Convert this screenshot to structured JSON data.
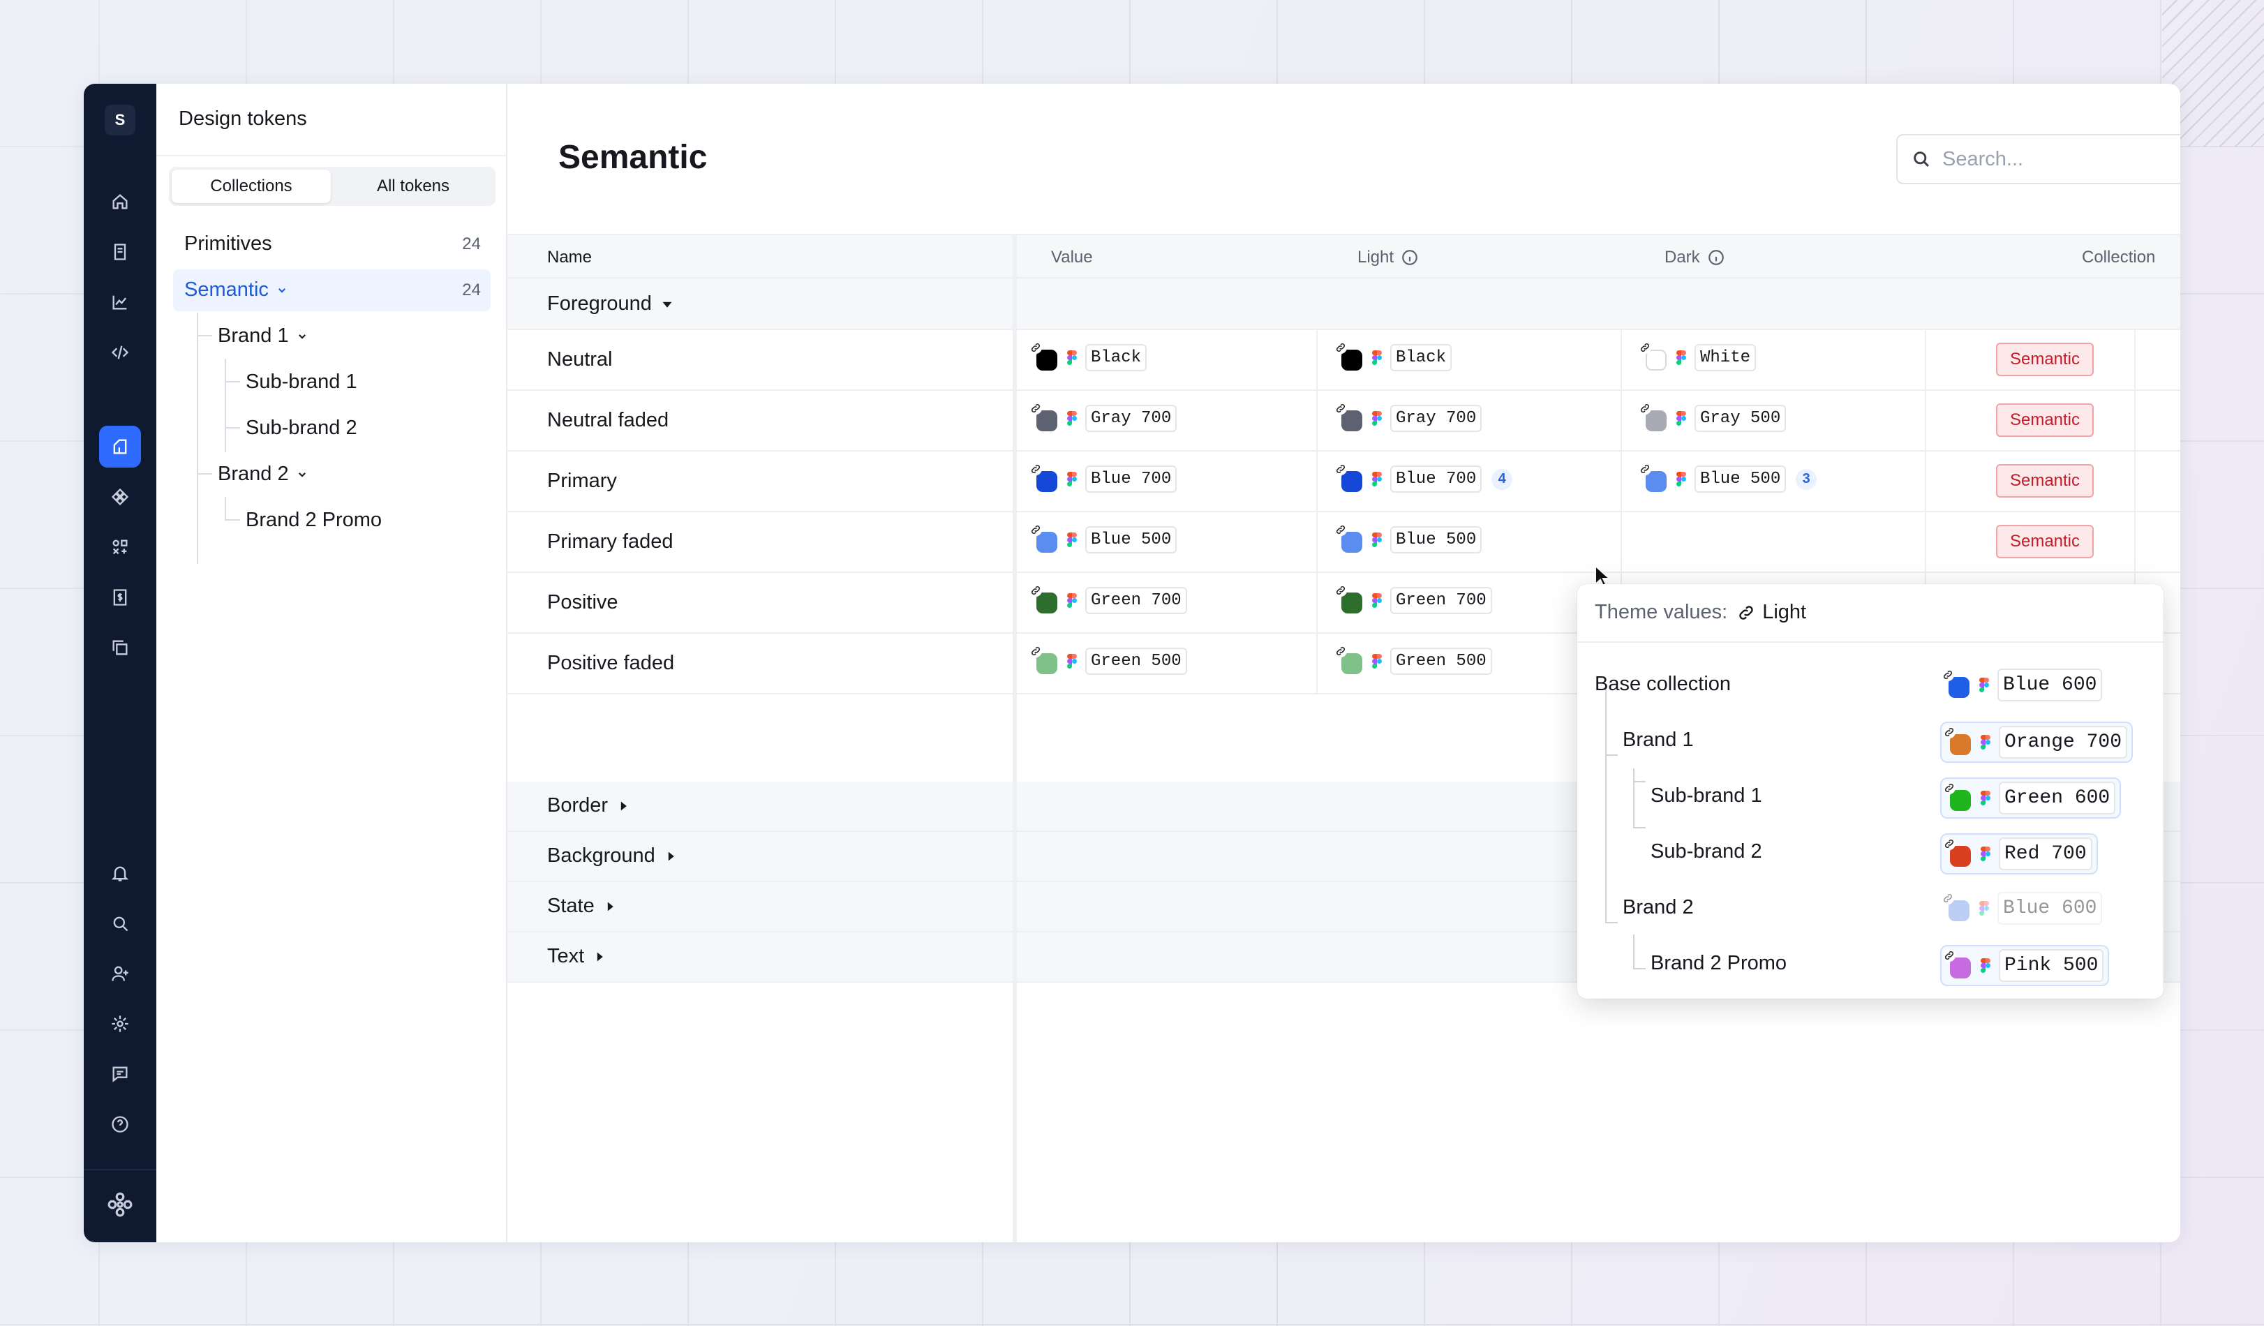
{
  "rail": {
    "workspace_initial": "S",
    "top_icons": [
      "home-icon",
      "book-icon",
      "chart-icon",
      "code-icon"
    ],
    "mid_icons": [
      "tokens-icon",
      "component-icon",
      "shapes-icon",
      "dollar-doc-icon",
      "copy-icon"
    ],
    "bottom_icons": [
      "bell-icon",
      "search-icon",
      "add-user-icon",
      "gear-icon",
      "chat-icon",
      "help-icon"
    ],
    "logo_icon": "flower-logo-icon"
  },
  "sidebar": {
    "title": "Design tokens",
    "tabs": [
      "Collections",
      "All tokens"
    ],
    "tree": [
      {
        "label": "Primitives",
        "count": "24"
      },
      {
        "label": "Semantic",
        "count": "24"
      },
      {
        "label": "Brand 1"
      },
      {
        "label": "Sub-brand 1"
      },
      {
        "label": "Sub-brand 2"
      },
      {
        "label": "Brand 2"
      },
      {
        "label": "Brand 2 Promo"
      }
    ]
  },
  "main": {
    "title": "Semantic",
    "search_placeholder": "Search...",
    "columns": [
      "Name",
      "Value",
      "Light",
      "Dark",
      "Collection"
    ],
    "groups": {
      "foreground": "Foreground",
      "border": "Border",
      "background": "Background",
      "state": "State",
      "text": "Text"
    },
    "rows": [
      {
        "name": "Neutral",
        "value": "Black",
        "light": "Black",
        "dark": "White",
        "collection": "Semantic",
        "value_color": "#000000",
        "light_color": "#000000",
        "dark_color": "#ffffff"
      },
      {
        "name": "Neutral faded",
        "value": "Gray 700",
        "light": "Gray 700",
        "dark": "Gray 500",
        "collection": "Semantic",
        "value_color": "#5d6270",
        "light_color": "#5d6270",
        "dark_color": "#a8abb4"
      },
      {
        "name": "Primary",
        "value": "Blue 700",
        "light": "Blue 700",
        "dark": "Blue 500",
        "collection": "Semantic",
        "value_color": "#1548d8",
        "light_color": "#1548d8",
        "dark_color": "#5b8cf0",
        "light_count": "4",
        "dark_count": "3"
      },
      {
        "name": "Primary faded",
        "value": "Blue 500",
        "light": "Blue 500",
        "dark": "",
        "collection": "Semantic",
        "value_color": "#5b8cf0",
        "light_color": "#5b8cf0"
      },
      {
        "name": "Positive",
        "value": "Green 700",
        "light": "Green 700",
        "dark": "",
        "collection": "Semantic",
        "value_color": "#2e6e2c",
        "light_color": "#2e6e2c"
      },
      {
        "name": "Positive faded",
        "value": "Green 500",
        "light": "Green 500",
        "dark": "",
        "collection": "Semantic",
        "value_color": "#7fc188",
        "light_color": "#7fc188"
      }
    ]
  },
  "popover": {
    "label": "Theme values:",
    "theme": "Light",
    "items": [
      {
        "name": "Base collection",
        "token": "Blue 600",
        "color": "#1f5fe6"
      },
      {
        "name": "Brand 1",
        "token": "Orange 700",
        "color": "#d97a2a"
      },
      {
        "name": "Sub-brand 1",
        "token": "Green 600",
        "color": "#1fb51f"
      },
      {
        "name": "Sub-brand 2",
        "token": "Red 700",
        "color": "#d8401f"
      },
      {
        "name": "Brand 2",
        "token": "Blue 600",
        "color": "#6f93e8"
      },
      {
        "name": "Brand 2 Promo",
        "token": "Pink 500",
        "color": "#c76be0"
      }
    ]
  },
  "colors": {
    "accent": "#2f6bff",
    "rail_bg": "#0f1a31",
    "badge_red": "#c31c2a"
  }
}
